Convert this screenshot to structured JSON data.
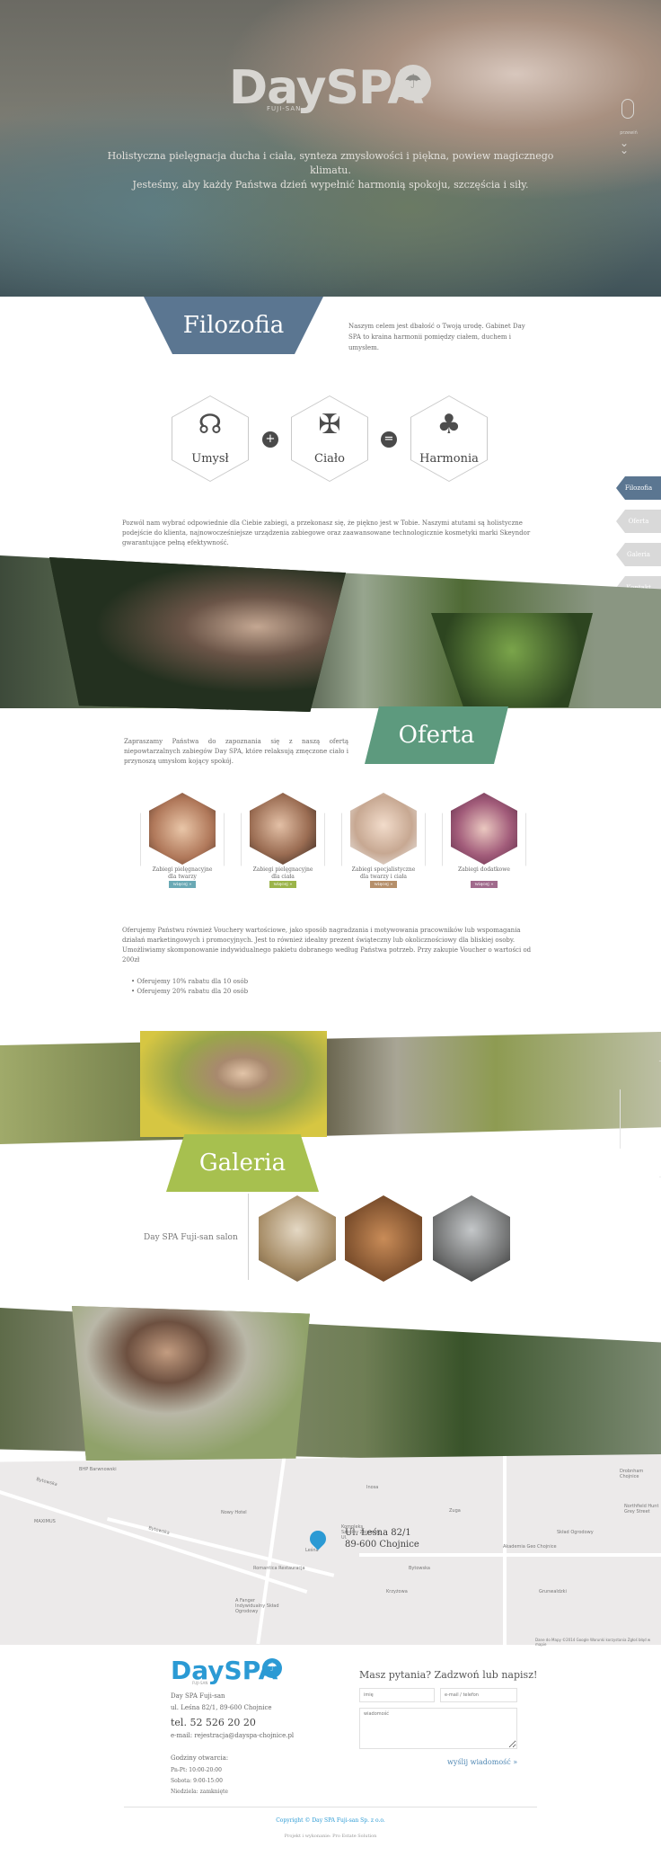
{
  "hero": {
    "logo": "DaySPA",
    "logo_sub": "FUJI-SAN",
    "tagline_1": "Holistyczna pielęgnacja ducha i ciała, synteza zmysłowości i piękna, powiew magicznego klimatu.",
    "tagline_2": "Jesteśmy, aby każdy Państwa dzień wypełnić harmonią spokoju, szczęścia i siły.",
    "scroll_label": "przewiń"
  },
  "nav": {
    "items": [
      {
        "label": "Filozofia"
      },
      {
        "label": "Oferta"
      },
      {
        "label": "Galeria"
      },
      {
        "label": "Kontakt"
      }
    ]
  },
  "filozofia": {
    "title": "Filozofia",
    "intro": "Naszym celem jest dbałość o Twoją urodę. Gabinet Day SPA to kraina harmonii pomiędzy ciałem, duchem i umysłem.",
    "hexes": [
      {
        "label": "Umysł",
        "icon": "brain-icon"
      },
      {
        "label": "Ciało",
        "icon": "yoga-pose-icon"
      },
      {
        "label": "Harmonia",
        "icon": "bonsai-icon"
      }
    ],
    "plus": "+",
    "equals": "=",
    "paragraph": "Pozwól nam wybrać odpowiednie dla Ciebie zabiegi, a przekonasz się, że piękno jest w Tobie. Naszymi atutami są holistyczne podejście do klienta, najnowocześniejsze urządzenia zabiegowe oraz zaawansowane technologicznie kosmetyki marki Skeyndor gwarantujące pełną efektywność."
  },
  "oferta": {
    "title": "Oferta",
    "intro": "Zapraszamy Państwa do zapoznania się z naszą ofertą niepowtarzalnych zabiegów Day SPA, które relaksują zmęczone ciało i przynoszą umysłom kojący spokój.",
    "items": [
      {
        "label_1": "Zabiegi pielęgnacyjne",
        "label_2": "dla twarzy",
        "button": "więcej »",
        "color": "#6aa9b5"
      },
      {
        "label_1": "Zabiegi pielęgnacyjne",
        "label_2": "dla ciała",
        "button": "więcej »",
        "color": "#9bb44a"
      },
      {
        "label_1": "Zabiegi specjalistyczne",
        "label_2": "dla twarzy i ciała",
        "button": "więcej »",
        "color": "#b58f6a"
      },
      {
        "label_1": "Zabiegi dodatkowe",
        "label_2": "",
        "button": "więcej »",
        "color": "#a06a8c"
      }
    ],
    "voucher": "Oferujemy Państwu również Vouchery wartościowe, jako sposób nagradzania i motywowania pracowników lub wspomagania działań marketingowych i promocyjnych. Jest to również idealny prezent świąteczny lub okolicznościowy dla bliskiej osoby. Umożliwiamy skomponowanie indywidualnego pakietu dobranego według Państwa potrzeb. Przy zakupie Voucher o wartości od 200zł",
    "bullets": [
      "Oferujemy 10% rabatu dla 10 osób",
      "Oferujemy 20% rabatu dla 20 osób"
    ]
  },
  "galeria": {
    "title": "Galeria",
    "label": "Day SPA Fuji-san salon"
  },
  "map": {
    "address_1": "Ul. Leśna 82/1",
    "address_2": "89-600 Chojnice",
    "labels": [
      "BHP Barwnowski",
      "Bytowska",
      "Bytowska",
      "MAXIMUS",
      "Nowy Hotel",
      "Romantica Restauracja",
      "Krzyżowa",
      "Grunwaldzki",
      "Drobnham Chojnice",
      "Northfield Hunt Grey Street",
      "Inosa",
      "Akademia Geo Chojnice",
      "Leśna",
      "Zuga",
      "Skład Ogrodowy",
      "Kompleks Szkolny Zbiorczej Ul.",
      "A Fanger Indywidualny Skład Ogrodowy",
      "Bytowska"
    ],
    "copyright": "Dane do Mapy ©2014 Google   Warunki korzystania   Zgłoś błąd w mapie"
  },
  "footer": {
    "logo": "DaySPA",
    "logo_sub": "FUJI-SAN",
    "name": "Day SPA Fuji-san",
    "address": "ul. Leśna 82/1, 89-600 Chojnice",
    "phone": "tel. 52 526 20 20",
    "email": "e-mail: rejestracja@dayspa-chojnice.pl",
    "hours_title": "Godziny otwarcia:",
    "hours": [
      "Pn-Pt: 10:00-20:00",
      "Sobota: 9:00-15:00",
      "Niedziela: zamknięte"
    ],
    "form_title": "Masz pytania? Zadzwoń lub napisz!",
    "name_placeholder": "imię",
    "email_placeholder": "e-mail / telefon",
    "message_placeholder": "wiadomość",
    "send": "wyślij wiadomość »",
    "copyright": "Copyright © Day SPA Fuji-san Sp. z o.o.",
    "credit": "Projekt i wykonanie: Pro Estate Solution"
  }
}
